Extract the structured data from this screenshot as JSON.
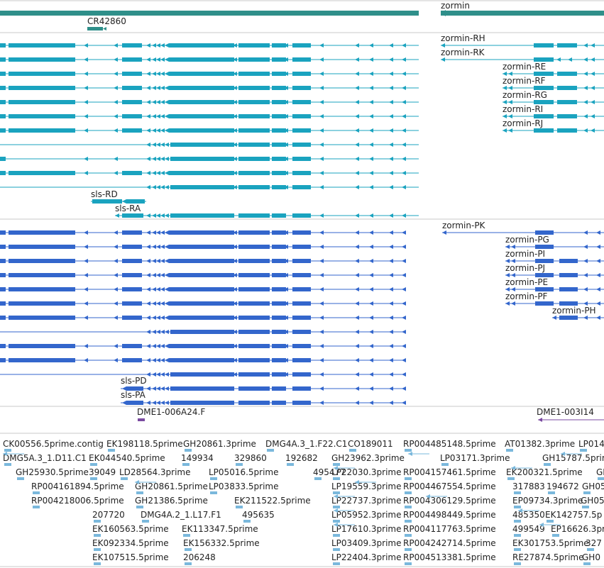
{
  "colors": {
    "gene": "#2f8f8a",
    "transcript": "#1aa3bf",
    "protein": "#3366cc",
    "bac": "#7a4aa0",
    "est": "#7ab8dc",
    "divider": "#c8c8c8"
  },
  "gene_track": {
    "gene_name": "zormin",
    "ncrna_name": "CR42860"
  },
  "transcript_track": {
    "zormin_labels": [
      "zormin-RH",
      "zormin-RK",
      "zormin-RE",
      "zormin-RF",
      "zormin-RG",
      "zormin-RI",
      "zormin-RJ"
    ],
    "sls_labels": [
      "sls-RD",
      "sls-RA"
    ]
  },
  "protein_track": {
    "zormin_labels": [
      "zormin-PK",
      "zormin-PG",
      "zormin-PI",
      "zormin-PJ",
      "zormin-PE",
      "zormin-PF",
      "zormin-PH"
    ],
    "sls_labels": [
      "sls-PD",
      "sls-PA"
    ]
  },
  "bac_track": {
    "clones": [
      "DME1-006A24.F",
      "DME1-003I14"
    ]
  },
  "est_track": {
    "labels": [
      "CK00556.5prime.contig",
      "EK198118.5prime",
      "GH20861.3prime",
      "DMG4A.3_1.F22.C1",
      "CO189011",
      "RP004485148.5prime",
      "AT01382.3prime",
      "LP014",
      "DMG5A.3_1.D11.C1",
      "EK044540.5prime",
      "149934",
      "329860",
      "192682",
      "GH23962.3prime",
      "LP03171.3prime",
      "GH15787.5prime",
      "GH25930.5prime",
      "39049",
      "LD28564.3prime",
      "LP05016.5prime",
      "495477",
      "LP22030.3prime",
      "RP004157461.5prime",
      "EK200321.5prime",
      "GH0",
      "RP004161894.5prime",
      "GH20861.5prime",
      "LP03833.5prime",
      "LP19559.3prime",
      "RP004467554.5prime",
      "317883",
      "194672",
      "GH05",
      "RP004218006.5prime",
      "GH21386.5prime",
      "EK211522.5prime",
      "LP22737.3prime",
      "RP004306129.5prime",
      "EP09734.3prime",
      "GH05",
      "207720",
      "DMG4A.2_1.L17.F1",
      "495635",
      "LP05952.3prime",
      "RP004498449.5prime",
      "485350",
      "EK142757.5p",
      "EK160563.5prime",
      "EK113347.5prime",
      "LP17610.3prime",
      "RP004117763.5prime",
      "499549",
      "EP16626.3pri",
      "EK092334.5prime",
      "EK156332.5prime",
      "LP03409.3prime",
      "RP004242714.5prime",
      "EK301753.5prime",
      "327",
      "EK107515.5prime",
      "206248",
      "LP22404.3prime",
      "RP004513381.5prime",
      "RE27874.5prime",
      "GH0"
    ]
  }
}
